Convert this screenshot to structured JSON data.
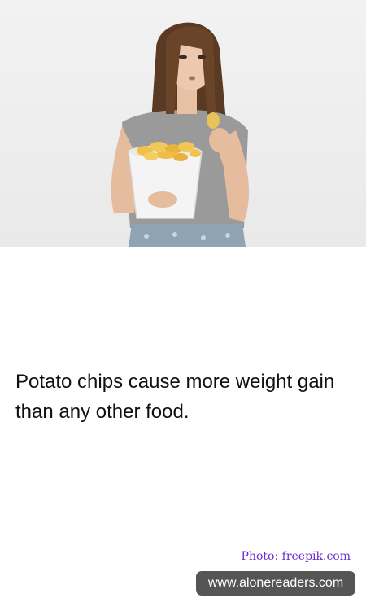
{
  "fact": {
    "text": "Potato chips cause more weight gain than any other food."
  },
  "photo": {
    "credit": "Photo: freepik.com",
    "subject_icon": "woman-holding-chips-bucket"
  },
  "badge": {
    "label": "www.alonereaders.com"
  },
  "colors": {
    "credit": "#6a2bd0",
    "badge_background": "#555555",
    "badge_text": "#ffffff",
    "text": "#111111"
  }
}
